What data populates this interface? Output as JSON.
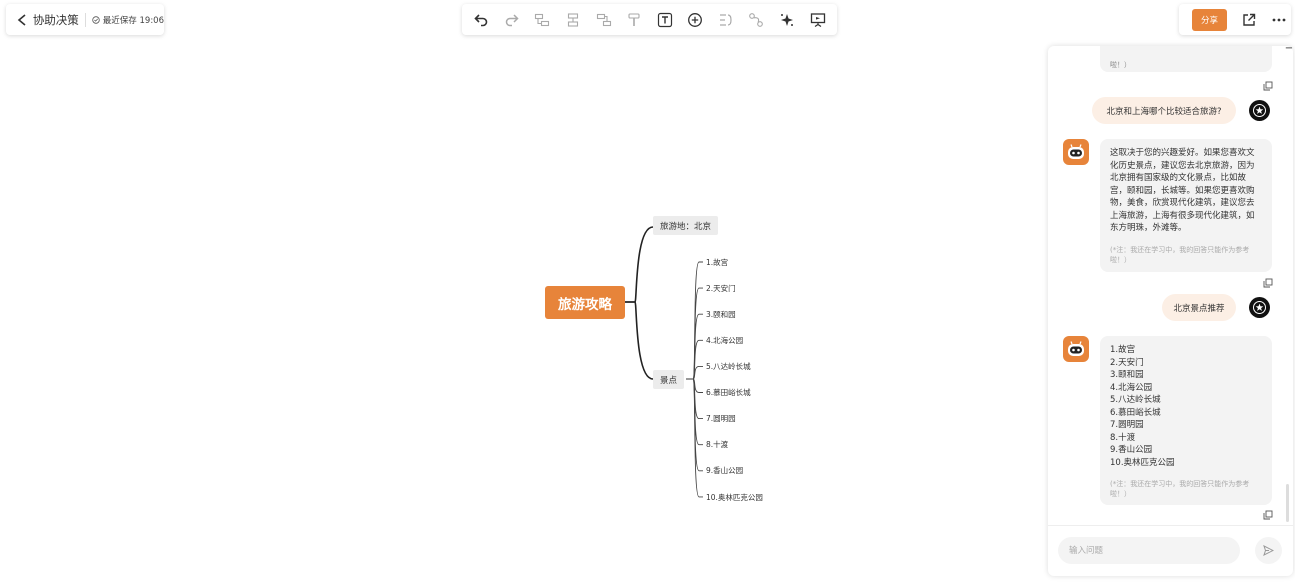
{
  "header": {
    "doc_title": "协助决策",
    "save_status": "最近保存 19:06"
  },
  "toolbar": {
    "tools": [
      "undo-icon",
      "redo-icon",
      "add-child-icon",
      "add-sibling-icon",
      "add-parent-icon",
      "format-painter-icon",
      "text-icon",
      "insert-icon",
      "summary-icon",
      "relation-icon",
      "ai-icon",
      "present-icon"
    ]
  },
  "topright": {
    "share_label": "分享"
  },
  "mindmap": {
    "root": "旅游攻略",
    "branches": [
      {
        "label": "旅游地：北京",
        "children": []
      },
      {
        "label": "景点",
        "children": [
          "1.故宫",
          "2.天安门",
          "3.颐和园",
          "4.北海公园",
          "5.八达岭长城",
          "6.慕田峪长城",
          "7.圆明园",
          "8.十渡",
          "9.香山公园",
          "10.奥林匹克公园"
        ]
      }
    ]
  },
  "chat": {
    "top_partial": "啦！）",
    "messages": [
      {
        "role": "user",
        "text": "北京和上海哪个比较适合旅游?"
      },
      {
        "role": "ai",
        "lines": [
          "这取决于您的兴趣爱好。如果您喜欢文",
          "化历史景点，建议您去北京旅游，因为",
          "北京拥有国家级的文化景点，比如故",
          "宫，颐和园，长城等。如果您更喜欢购",
          "物，美食，欣赏现代化建筑，建议您去",
          "上海旅游，上海有很多现代化建筑，如",
          "东方明珠，外滩等。"
        ],
        "note": [
          "(*注：我还在学习中，我的回答只能作为参考",
          "啦！）"
        ]
      },
      {
        "role": "user",
        "text": "北京景点推荐"
      },
      {
        "role": "ai",
        "lines": [
          "1.故宫",
          "2.天安门",
          "3.颐和园",
          "4.北海公园",
          "5.八达岭长城",
          "6.慕田峪长城",
          "7.圆明园",
          "8.十渡",
          "9.香山公园",
          "10.奥林匹克公园"
        ],
        "note": [
          "(*注：我还在学习中，我的回答只能作为参考",
          "啦！）"
        ]
      }
    ],
    "input_placeholder": "输入问题"
  },
  "colors": {
    "accent": "#e7843a",
    "branch_bg": "#ececec",
    "user_bubble": "#fcefe5",
    "ai_bubble": "#f3f3f3"
  }
}
